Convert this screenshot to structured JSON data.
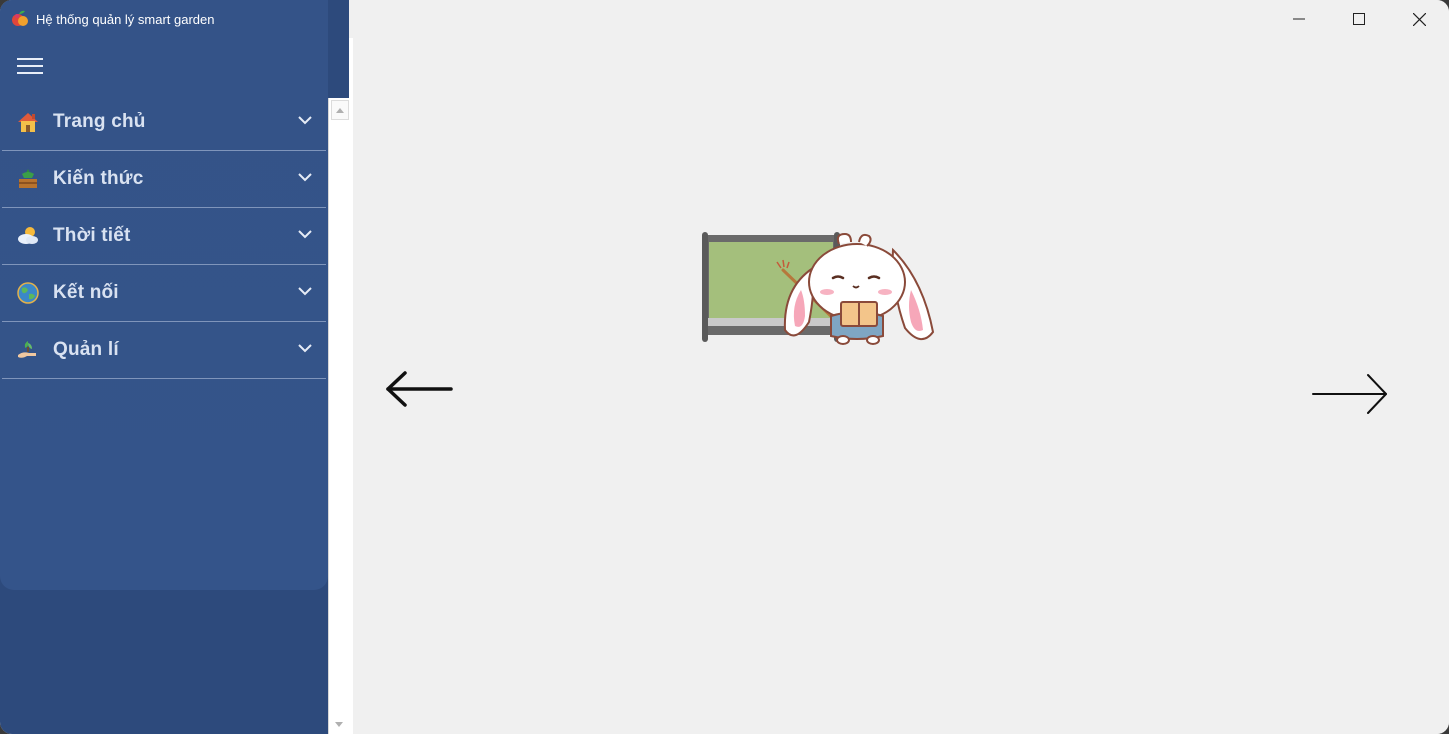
{
  "window": {
    "title": "Hệ thống quản lý smart garden"
  },
  "sidebar": {
    "hamburger_icon": "hamburger-menu-icon",
    "items": [
      {
        "label": "Trang chủ",
        "icon": "house-icon"
      },
      {
        "label": "Kiến thức",
        "icon": "plant-basket-icon"
      },
      {
        "label": "Thời tiết",
        "icon": "weather-cloud-sun-icon"
      },
      {
        "label": "Kết nối",
        "icon": "globe-icon"
      },
      {
        "label": "Quản lí",
        "icon": "hand-plant-icon"
      }
    ]
  },
  "main": {
    "illustration": "bunny-teacher-at-chalkboard",
    "prev_icon": "arrow-left-icon",
    "next_icon": "arrow-right-icon"
  },
  "colors": {
    "sidebar_bg": "#2d4a7c",
    "sidebar_panel": "#34548a",
    "main_bg": "#f0f0f0",
    "menu_text": "#d9e2f1",
    "divider": "#7f95bb"
  }
}
